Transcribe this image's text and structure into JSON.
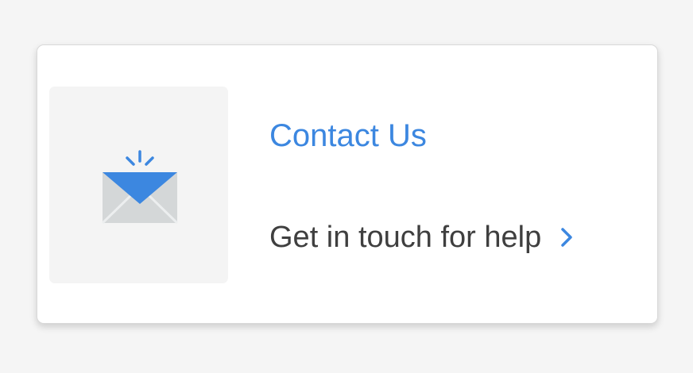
{
  "card": {
    "title": "Contact Us",
    "subtitle": "Get in touch for help"
  },
  "icons": {
    "main": "envelope-notification-icon",
    "action": "chevron-right-icon"
  },
  "colors": {
    "accent": "#3c87e0",
    "text": "#3f3f3f",
    "envelope_body": "#d4d7d8",
    "envelope_flap": "#3c87e0",
    "tile_background": "#f4f4f4",
    "page_background": "#f5f5f5"
  }
}
